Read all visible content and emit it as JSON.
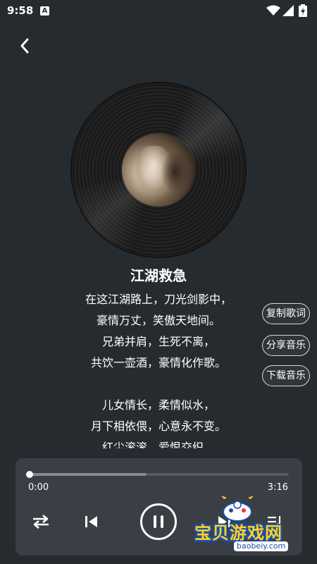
{
  "status_bar": {
    "time": "9:58",
    "badge": "A",
    "icons": [
      "wifi-icon",
      "signal-icon",
      "battery-icon"
    ]
  },
  "navigation": {
    "back_icon": "chevron-left-icon"
  },
  "song": {
    "title": "江湖救急"
  },
  "lyrics": [
    "在这江湖路上，刀光剑影中，",
    "豪情万丈，笑傲天地间。",
    "兄弟并肩，生死不离，",
    "共饮一壶酒，豪情化作歌。",
    "",
    "儿女情长，柔情似水，",
    "月下相依偎，心意永不变。",
    "红尘滚滚，爱恨交织，"
  ],
  "side_actions": {
    "copy_lyrics": "复制歌词",
    "share_music": "分享音乐",
    "download_music": "下载音乐"
  },
  "player": {
    "current_time": "0:00",
    "duration": "3:16",
    "buffered_fraction": 0.45,
    "played_fraction": 0.0,
    "controls": [
      "shuffle-icon",
      "previous-icon",
      "pause-icon",
      "next-icon",
      "playlist-icon"
    ]
  },
  "watermark": {
    "text": "宝贝游戏网",
    "url": "baobeiy.com"
  },
  "colors": {
    "background": "#262b30",
    "player_panel": "#3a3f45",
    "text": "#ffffff",
    "watermark_yellow": "#ffd21f",
    "watermark_blue": "#1a4fa8"
  }
}
